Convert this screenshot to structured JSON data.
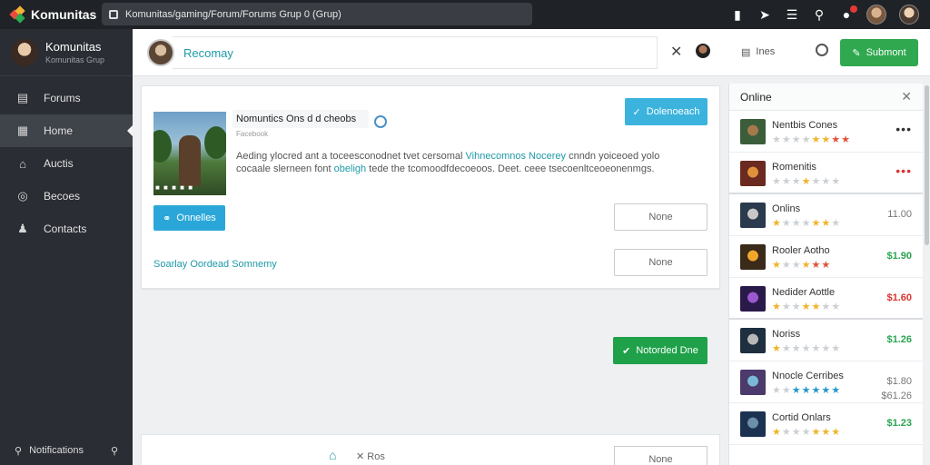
{
  "topbar": {
    "brand": "Komunitas",
    "address": "Komunitas/gaming/Forum/Forums Grup 0 (Grup)",
    "icons": [
      "bookmark-icon",
      "rocket-icon",
      "news-icon",
      "search-icon",
      "notification-icon"
    ]
  },
  "sidebar": {
    "profile_name": "Komunitas",
    "profile_sub": "Komunitas Grup",
    "items": [
      {
        "label": "Forums",
        "icon": "forum-icon"
      },
      {
        "label": "Home",
        "icon": "home-icon"
      },
      {
        "label": "Auctis",
        "icon": "auction-icon"
      },
      {
        "label": "Becoes",
        "icon": "circle-icon"
      },
      {
        "label": "Contacts",
        "icon": "user-icon"
      }
    ],
    "footer_label": "Notifications"
  },
  "header": {
    "title": "Recomay",
    "user_label": "Ines",
    "submit_label": "Submont"
  },
  "card": {
    "title": "Nomuntics Ons d d cheobs",
    "subtitle": "Facebook",
    "description_parts": [
      "Aeding ylocred ant a toceesconodnet tvet cersomal ",
      "Vihnecomnos Nocerey",
      " cnndn yoiceoed yolo cocaale slerneen font ",
      "obeligh",
      " tede the tcomoodfdecoeoos. Deet. ceee tsecoenltceoeonenmgs."
    ],
    "download_label": "Dolenoeach",
    "online_label": "Onnelles",
    "none_label_1": "None",
    "none_label_2": "None",
    "link_label": "Soarlay Oordead Somnemy"
  },
  "green_button_label": "Notorded Dne",
  "bottom_card": {
    "label": "Ros",
    "button_label": "None"
  },
  "right_panel": {
    "title": "Online",
    "items": [
      {
        "name": "Nentbis Cones",
        "stars": [
          0,
          0,
          0,
          0,
          1,
          1,
          2,
          2
        ],
        "price": "",
        "dots": "•••",
        "dots_color": "dark"
      },
      {
        "name": "Romenitis",
        "stars": [
          0,
          0,
          0,
          1,
          0,
          0,
          0
        ],
        "price": "",
        "dots": "•••",
        "dots_color": "red"
      },
      {
        "name": "Onlins",
        "stars": [
          1,
          0,
          0,
          0,
          1,
          1,
          0
        ],
        "price": "11.00",
        "price_color": "gray"
      },
      {
        "name": "Rooler Aotho",
        "stars": [
          1,
          0,
          0,
          1,
          2,
          2
        ],
        "price": "$1.90",
        "price_color": "green"
      },
      {
        "name": "Nedider Aottle",
        "stars": [
          1,
          0,
          0,
          1,
          1,
          0,
          0
        ],
        "price": "$1.60",
        "price_color": "red"
      },
      {
        "name": "Noriss",
        "stars": [
          1,
          0,
          0,
          0,
          0,
          0,
          0
        ],
        "price": "$1.26",
        "price_color": "green"
      },
      {
        "name": "Nnocle Cerribes",
        "stars": [
          0,
          0,
          3,
          3,
          3,
          3,
          3
        ],
        "price": "$1.80",
        "price_color": "gray",
        "extra_price": "$61.26"
      },
      {
        "name": "Cortid Onlars",
        "stars": [
          1,
          0,
          0,
          0,
          1,
          1,
          1
        ],
        "price": "$1.23",
        "price_color": "green"
      }
    ]
  },
  "colors": {
    "accent_teal": "#1f9aa8",
    "primary_green": "#2fa84f",
    "info_blue": "#3bb3dd",
    "sidebar_bg": "#2a2d33",
    "topbar_bg": "#1f2226"
  }
}
